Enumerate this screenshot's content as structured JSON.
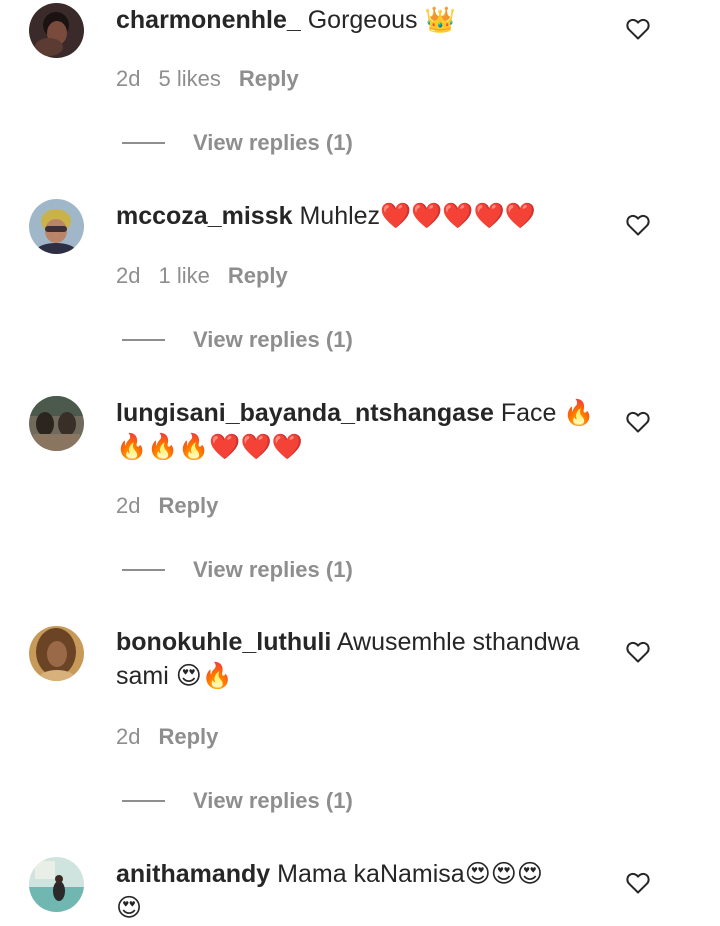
{
  "comments": [
    {
      "username": "charmonenhle_",
      "text": " Gorgeous ",
      "emoji": "👑",
      "emoji2": "",
      "time": "2d",
      "likes": "5 likes",
      "reply": "Reply",
      "view_replies": "View replies (1)"
    },
    {
      "username": "mccoza_missk",
      "text": " Muhlez",
      "emoji": "❤️❤️❤️❤️❤️",
      "emoji2": "",
      "time": "2d",
      "likes": "1 like",
      "reply": "Reply",
      "view_replies": "View replies (1)"
    },
    {
      "username": "lungisani_bayanda_ntshangase",
      "text": " Face ",
      "emoji": "🔥",
      "emoji2": "🔥🔥🔥❤️❤️❤️",
      "time": "2d",
      "likes": "",
      "reply": "Reply",
      "view_replies": "View replies (1)"
    },
    {
      "username": "bonokuhle_luthuli",
      "text": " Awusemhle sthandwa sami ",
      "emoji": "😍🔥",
      "emoji2": "",
      "time": "2d",
      "likes": "",
      "reply": "Reply",
      "view_replies": "View replies (1)"
    },
    {
      "username": "anithamandy",
      "text": " Mama kaNamisa",
      "emoji": "😍😍😍",
      "emoji2": "😍",
      "time": "",
      "likes": "",
      "reply": "",
      "view_replies": ""
    }
  ]
}
